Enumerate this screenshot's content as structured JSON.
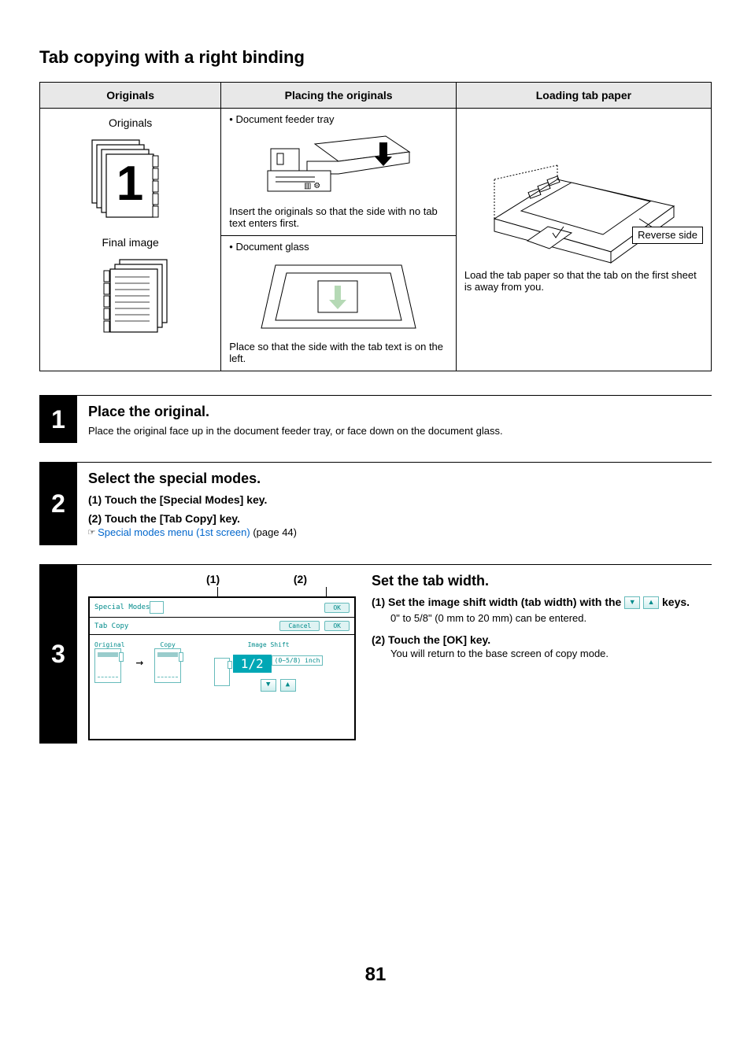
{
  "title": "Tab copying with a right binding",
  "table": {
    "headers": [
      "Originals",
      "Placing the originals",
      "Loading tab paper"
    ],
    "col1": {
      "label_originals": "Originals",
      "label_final": "Final image",
      "big_digit": "1"
    },
    "col2": {
      "bullet1": "• Document feeder tray",
      "cap1": "Insert the originals so that the side with no tab text enters first.",
      "bullet2": "• Document glass",
      "cap2": "Place so that the side with the tab text is on the left."
    },
    "col3": {
      "callout": "Reverse side",
      "cap": "Load the tab paper so that the tab on the first sheet is away from you."
    }
  },
  "steps": {
    "s1": {
      "num": "1",
      "heading": "Place the original.",
      "text": "Place the original face up in the document feeder tray, or face down on the document glass."
    },
    "s2": {
      "num": "2",
      "heading": "Select the special modes.",
      "sub1": "(1)   Touch the [Special Modes] key.",
      "sub2": "(2)   Touch the [Tab Copy] key.",
      "ref_icon": "☞",
      "ref_link": "Special modes menu (1st screen)",
      "ref_tail": " (page 44)"
    },
    "s3": {
      "num": "3",
      "heading": "Set the tab width.",
      "label1": "(1)",
      "label2": "(2)",
      "panel": {
        "special_modes": "Special Modes",
        "tab_copy": "Tab Copy",
        "ok": "OK",
        "cancel": "Cancel",
        "original": "Original",
        "copy": "Copy",
        "image_shift": "Image Shift",
        "value": "1/2",
        "unit": "(0~5/8) inch"
      },
      "r_sub1": "(1)   Set the image shift width (tab width) with the ",
      "r_sub1_tail": " keys.",
      "range": "0\" to 5/8\" (0 mm to 20 mm) can be entered.",
      "r_sub2": "(2)   Touch the [OK] key.",
      "r_sub2_body": "You will return to the base screen of copy mode."
    }
  },
  "page_no": "81"
}
